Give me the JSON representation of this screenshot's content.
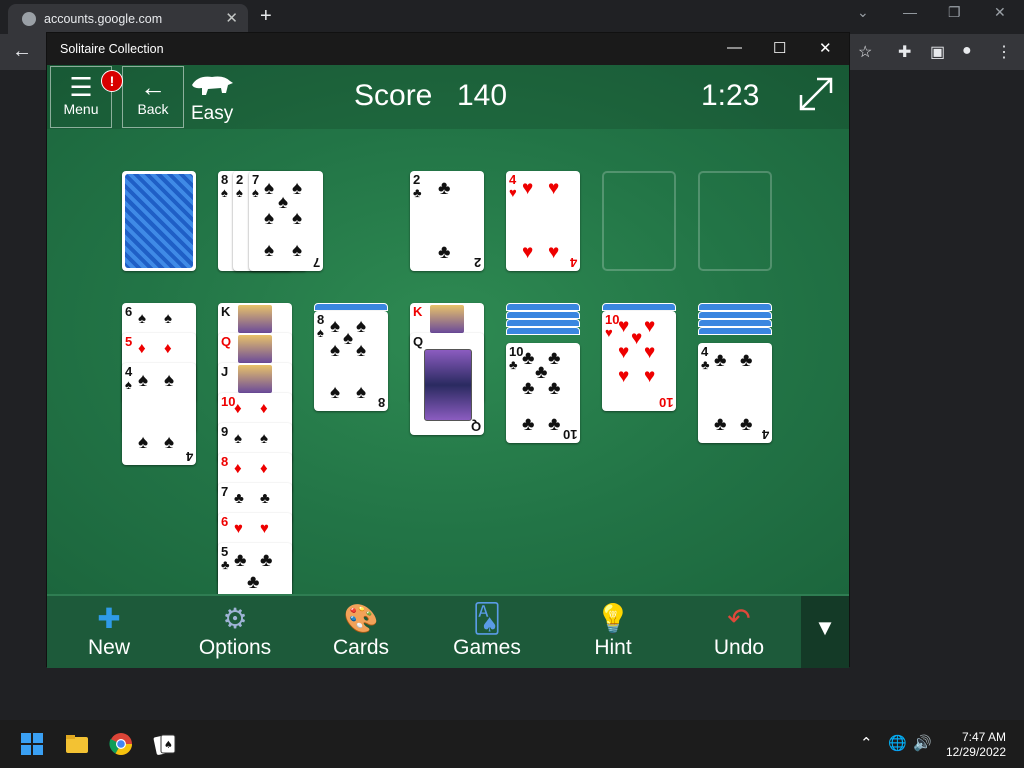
{
  "browser": {
    "tab_title": "accounts.google.com",
    "tab_close": "✕",
    "new_tab": "+"
  },
  "app": {
    "title": "Solitaire Collection",
    "header": {
      "menu_label": "Menu",
      "menu_badge": "!",
      "back_label": "Back",
      "difficulty": "Easy",
      "score_label": "Score",
      "score_value": "140",
      "timer": "1:23"
    },
    "toolbar": [
      {
        "label": "New",
        "icon": "plus-icon"
      },
      {
        "label": "Options",
        "icon": "gear-icon"
      },
      {
        "label": "Cards",
        "icon": "palette-icon"
      },
      {
        "label": "Games",
        "icon": "cards-fan-icon"
      },
      {
        "label": "Hint",
        "icon": "lightbulb-icon"
      },
      {
        "label": "Undo",
        "icon": "undo-icon"
      }
    ]
  },
  "board": {
    "waste_ranks": [
      "8",
      "2",
      "7"
    ],
    "waste_top": {
      "rank": "7",
      "suit": "♠"
    },
    "foundation_1": {
      "rank": "2",
      "suit": "♣"
    },
    "foundation_2": {
      "rank": "4",
      "suit": "♥"
    },
    "tableau_1": [
      "6",
      "5",
      "4"
    ],
    "tableau_2": [
      "K",
      "Q",
      "J",
      "10",
      "9",
      "8",
      "7",
      "6",
      "5"
    ],
    "tableau_3": "8",
    "tableau_4": [
      "K",
      "Q"
    ],
    "tableau_5": "10",
    "tableau_6": "10",
    "tableau_7": "4"
  },
  "taskbar": {
    "time": "7:47 AM",
    "date": "12/29/2022"
  }
}
